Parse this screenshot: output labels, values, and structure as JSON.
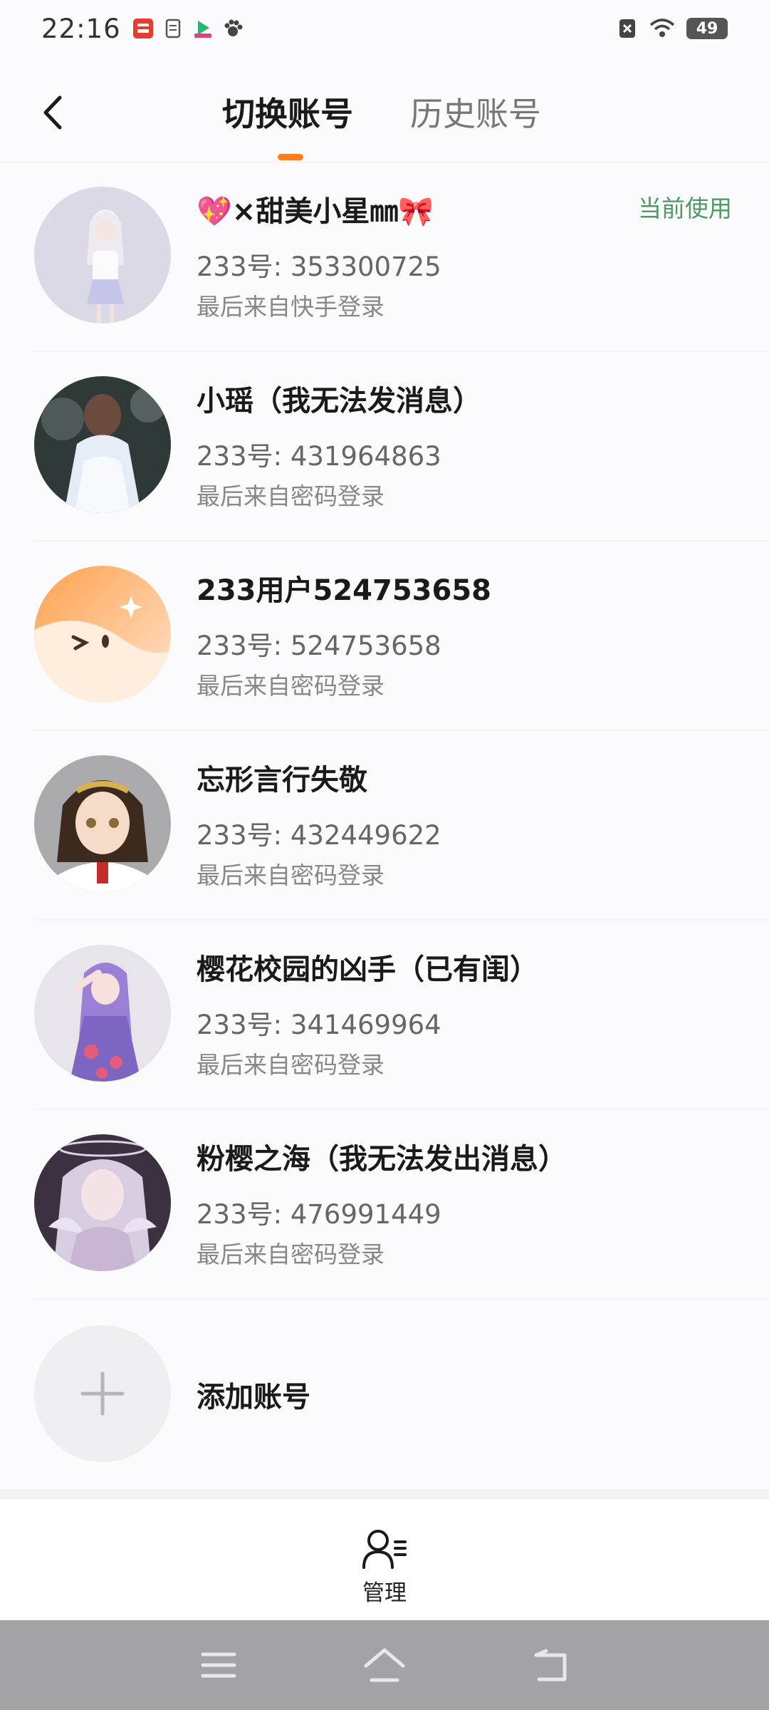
{
  "status_bar": {
    "time": "22:16",
    "battery": "49",
    "icons": [
      "app-notification-icon",
      "document-icon",
      "video-app-icon",
      "paw-app-icon",
      "sim-off-icon",
      "wifi-icon",
      "battery-icon"
    ]
  },
  "header": {
    "back_icon": "chevron-left-icon",
    "tabs": [
      {
        "label": "切换账号",
        "active": true
      },
      {
        "label": "历史账号",
        "active": false
      }
    ],
    "accent_color": "#ff7d1f"
  },
  "accounts": [
    {
      "name": "💖×甜美小星㎜🎀",
      "id": "233号: 353300725",
      "login": "最后来自快手登录",
      "current_label": "当前使用",
      "avatar": "anime-girl-white-hair"
    },
    {
      "name": "小瑶（我无法发消息）",
      "id": "233号: 431964863",
      "login": "最后来自密码登录",
      "avatar": "girl-white-dress"
    },
    {
      "name": "233用户524753658",
      "id": "233号: 524753658",
      "login": "最后来自密码登录",
      "avatar": "orange-mascot"
    },
    {
      "name": "忘形言行失敬",
      "id": "233号: 432449622",
      "login": "最后来自密码登录",
      "avatar": "anime-girl-brown-hair"
    },
    {
      "name": "樱花校园的凶手（已有闺）",
      "id": "233号: 341469964",
      "login": "最后来自密码登录",
      "avatar": "anime-girl-purple-hair"
    },
    {
      "name": "粉樱之海（我无法发出消息）",
      "id": "233号: 476991449",
      "login": "最后来自密码登录",
      "avatar": "anime-girl-pastel"
    }
  ],
  "add_account": {
    "label": "添加账号",
    "icon": "plus-icon"
  },
  "manage": {
    "label": "管理",
    "icon": "user-list-icon"
  },
  "nav": {
    "icons": [
      "menu-icon",
      "home-icon",
      "back-icon"
    ]
  },
  "colors": {
    "current_green": "#4f9a62",
    "nav_bar": "#a3a3a5"
  }
}
